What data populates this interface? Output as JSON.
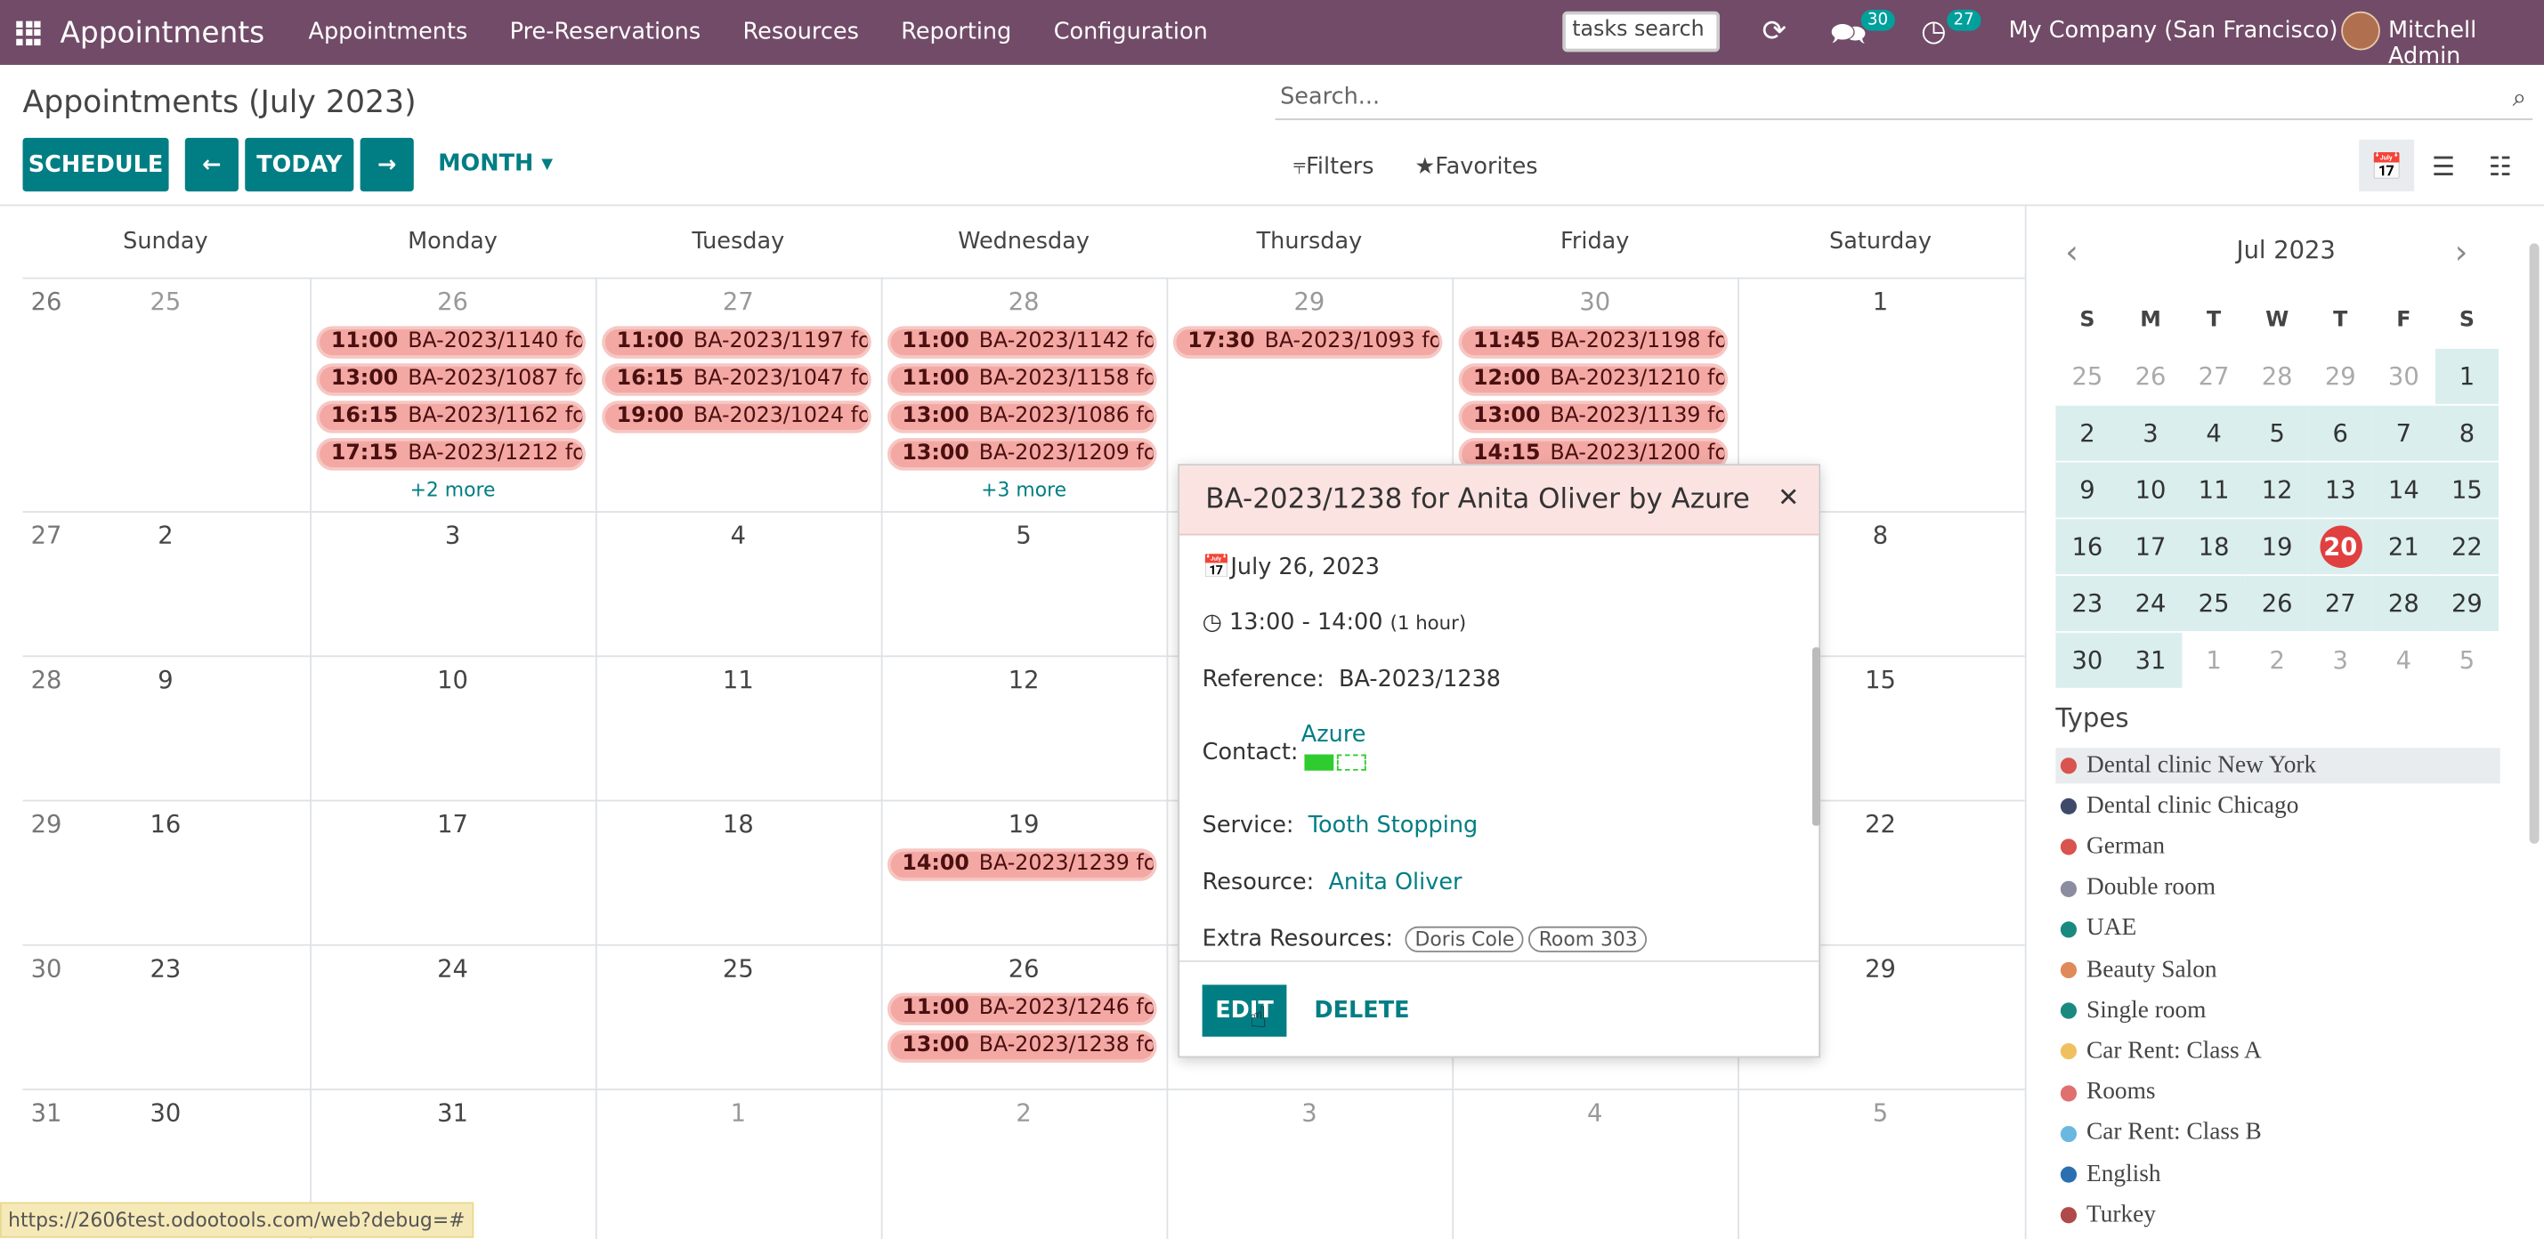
{
  "topbar": {
    "app_title": "Appointments",
    "nav": [
      "Appointments",
      "Pre-Reservations",
      "Resources",
      "Reporting",
      "Configuration"
    ],
    "tasks_search": "tasks search",
    "chat_badge": "30",
    "activity_badge": "27",
    "company": "My Company (San Francisco)",
    "user": "Mitchell Admin",
    "colors": {
      "bar": "#714B67",
      "badge": "#00A09D"
    }
  },
  "control": {
    "title": "Appointments (July 2023)",
    "schedule": "SCHEDULE",
    "today": "TODAY",
    "month": "MONTH",
    "search_placeholder": "Search...",
    "filters": "Filters",
    "favorites": "Favorites"
  },
  "calendar": {
    "daynames": [
      "Sunday",
      "Monday",
      "Tuesday",
      "Wednesday",
      "Thursday",
      "Friday",
      "Saturday"
    ],
    "weeks": [
      {
        "wk": "26",
        "days": [
          "25",
          "26",
          "27",
          "28",
          "29",
          "30",
          "1"
        ]
      },
      {
        "wk": "27",
        "days": [
          "2",
          "3",
          "4",
          "5",
          "6",
          "7",
          "8"
        ]
      },
      {
        "wk": "28",
        "days": [
          "9",
          "10",
          "11",
          "12",
          "13",
          "14",
          "15"
        ]
      },
      {
        "wk": "29",
        "days": [
          "16",
          "17",
          "18",
          "19",
          "20",
          "21",
          "22"
        ]
      },
      {
        "wk": "30",
        "days": [
          "23",
          "24",
          "25",
          "26",
          "27",
          "28",
          "29"
        ]
      },
      {
        "wk": "31",
        "days": [
          "30",
          "31",
          "1",
          "2",
          "3",
          "4",
          "5"
        ]
      }
    ],
    "events": [
      {
        "w": 0,
        "d": 1,
        "slot": 0,
        "time": "11:00",
        "label": "BA-2023/1140 fo..."
      },
      {
        "w": 0,
        "d": 1,
        "slot": 1,
        "time": "13:00",
        "label": "BA-2023/1087 fo..."
      },
      {
        "w": 0,
        "d": 1,
        "slot": 2,
        "time": "16:15",
        "label": "BA-2023/1162 fo..."
      },
      {
        "w": 0,
        "d": 1,
        "slot": 3,
        "time": "17:15",
        "label": "BA-2023/1212 fo..."
      },
      {
        "w": 0,
        "d": 2,
        "slot": 0,
        "time": "11:00",
        "label": "BA-2023/1197 fo..."
      },
      {
        "w": 0,
        "d": 2,
        "slot": 1,
        "time": "16:15",
        "label": "BA-2023/1047 fo..."
      },
      {
        "w": 0,
        "d": 2,
        "slot": 2,
        "time": "19:00",
        "label": "BA-2023/1024 fo..."
      },
      {
        "w": 0,
        "d": 3,
        "slot": 0,
        "time": "11:00",
        "label": "BA-2023/1142 fo..."
      },
      {
        "w": 0,
        "d": 3,
        "slot": 1,
        "time": "11:00",
        "label": "BA-2023/1158 fo..."
      },
      {
        "w": 0,
        "d": 3,
        "slot": 2,
        "time": "13:00",
        "label": "BA-2023/1086 fo..."
      },
      {
        "w": 0,
        "d": 3,
        "slot": 3,
        "time": "13:00",
        "label": "BA-2023/1209 fo..."
      },
      {
        "w": 0,
        "d": 4,
        "slot": 0,
        "time": "17:30",
        "label": "BA-2023/1093 fo..."
      },
      {
        "w": 0,
        "d": 5,
        "slot": 0,
        "time": "11:45",
        "label": "BA-2023/1198 fo..."
      },
      {
        "w": 0,
        "d": 5,
        "slot": 1,
        "time": "12:00",
        "label": "BA-2023/1210 fo..."
      },
      {
        "w": 0,
        "d": 5,
        "slot": 2,
        "time": "13:00",
        "label": "BA-2023/1139 fo..."
      },
      {
        "w": 0,
        "d": 5,
        "slot": 3,
        "time": "14:15",
        "label": "BA-2023/1200 fo..."
      },
      {
        "w": 3,
        "d": 3,
        "slot": 0,
        "time": "14:00",
        "label": "BA-2023/1239 fo..."
      },
      {
        "w": 4,
        "d": 3,
        "slot": 0,
        "time": "11:00",
        "label": "BA-2023/1246 fo..."
      },
      {
        "w": 4,
        "d": 3,
        "slot": 1,
        "time": "13:00",
        "label": "BA-2023/1238 fo..."
      }
    ],
    "more": [
      {
        "w": 0,
        "d": 1,
        "label": "+2 more"
      },
      {
        "w": 0,
        "d": 3,
        "label": "+3 more"
      }
    ]
  },
  "popover": {
    "title": "BA-2023/1238 for Anita Oliver by Azure",
    "date": "July 26, 2023",
    "time": "13:00 - 14:00",
    "duration": "(1 hour)",
    "reference_label": "Reference:",
    "reference": "BA-2023/1238",
    "contact_label": "Contact:",
    "contact": "Azure",
    "service_label": "Service:",
    "service": "Tooth Stopping",
    "resource_label": "Resource:",
    "resource": "Anita Oliver",
    "extra_label": "Extra Resources:",
    "extra": [
      "Doris Cole",
      "Room 303"
    ],
    "edit": "EDIT",
    "delete": "DELETE"
  },
  "minical": {
    "month": "Jul 2023",
    "headers": [
      "S",
      "M",
      "T",
      "W",
      "T",
      "F",
      "S"
    ],
    "weeks": [
      [
        "25",
        "26",
        "27",
        "28",
        "29",
        "30",
        "1"
      ],
      [
        "2",
        "3",
        "4",
        "5",
        "6",
        "7",
        "8"
      ],
      [
        "9",
        "10",
        "11",
        "12",
        "13",
        "14",
        "15"
      ],
      [
        "16",
        "17",
        "18",
        "19",
        "20",
        "21",
        "22"
      ],
      [
        "23",
        "24",
        "25",
        "26",
        "27",
        "28",
        "29"
      ],
      [
        "30",
        "31",
        "1",
        "2",
        "3",
        "4",
        "5"
      ]
    ],
    "today": "20"
  },
  "types": {
    "title": "Types",
    "items": [
      {
        "label": "Dental clinic New York",
        "color": "#d9534f"
      },
      {
        "label": "Dental clinic Chicago",
        "color": "#3f4a6b"
      },
      {
        "label": "German",
        "color": "#d9534f"
      },
      {
        "label": "Double room",
        "color": "#8c8ca0"
      },
      {
        "label": "UAE",
        "color": "#1a8a80"
      },
      {
        "label": "Beauty Salon",
        "color": "#e08a5a"
      },
      {
        "label": "Single room",
        "color": "#1a8a80"
      },
      {
        "label": "Car Rent: Class A",
        "color": "#f0c060"
      },
      {
        "label": "Rooms",
        "color": "#e07070"
      },
      {
        "label": "Car Rent: Class B",
        "color": "#6ab8e0"
      },
      {
        "label": "English",
        "color": "#2a70b0"
      },
      {
        "label": "Turkey",
        "color": "#b04a4a"
      }
    ]
  },
  "status_url": "https://2606test.odootools.com/web?debug=#"
}
